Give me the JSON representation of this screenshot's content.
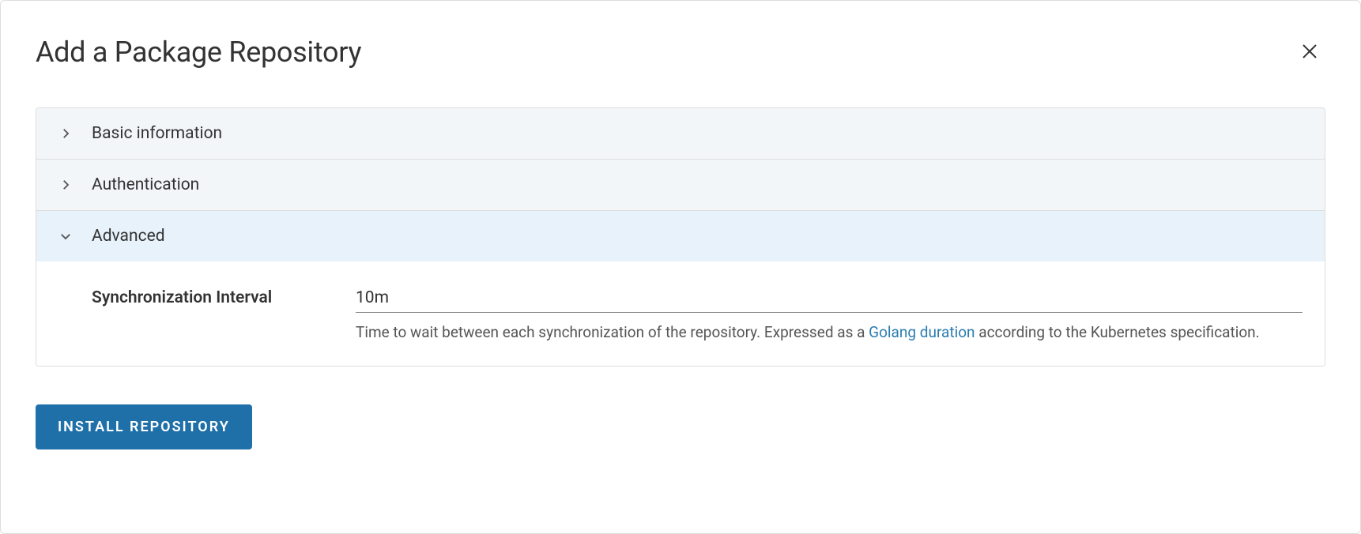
{
  "modal": {
    "title": "Add a Package Repository"
  },
  "sections": {
    "basic": {
      "label": "Basic information"
    },
    "auth": {
      "label": "Authentication"
    },
    "advanced": {
      "label": "Advanced",
      "fields": {
        "syncInterval": {
          "label": "Synchronization Interval",
          "value": "10m",
          "help_prefix": "Time to wait between each synchronization of the repository. Expressed as a ",
          "help_link_text": "Golang duration",
          "help_suffix": " according to the Kubernetes specification."
        }
      }
    }
  },
  "footer": {
    "submit_label": "Install Repository"
  }
}
